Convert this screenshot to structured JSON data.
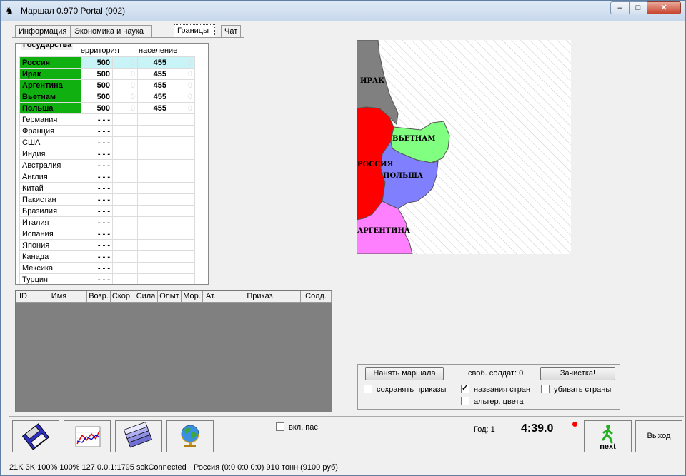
{
  "window": {
    "title": "Маршал 0.970   Portal (002)",
    "controls": {
      "minimize": "–",
      "maximize": "□",
      "close": "✕"
    }
  },
  "tabs": [
    {
      "label": "Информация"
    },
    {
      "label": "Экономика и наука"
    },
    {
      "label": "Границы"
    },
    {
      "label": "Чат"
    }
  ],
  "states_panel": {
    "title": "Государства",
    "headers": {
      "territory": "территория",
      "population": "население"
    },
    "rows": [
      {
        "name": "Россия",
        "territory": "500",
        "population": "455",
        "extra1": "0",
        "extra2": "0"
      },
      {
        "name": "Ирак",
        "territory": "500",
        "population": "455",
        "extra1": "0",
        "extra2": "0"
      },
      {
        "name": "Аргентина",
        "territory": "500",
        "population": "455",
        "extra1": "0",
        "extra2": "0"
      },
      {
        "name": "Вьетнам",
        "territory": "500",
        "population": "455",
        "extra1": "0",
        "extra2": "0"
      },
      {
        "name": "Польша",
        "territory": "500",
        "population": "455",
        "extra1": "0",
        "extra2": "0"
      },
      {
        "name": "Германия",
        "territory": "- - -",
        "population": "",
        "extra1": "",
        "extra2": ""
      },
      {
        "name": "Франция",
        "territory": "- - -",
        "population": "",
        "extra1": "",
        "extra2": ""
      },
      {
        "name": "США",
        "territory": "- - -",
        "population": "",
        "extra1": "",
        "extra2": ""
      },
      {
        "name": "Индия",
        "territory": "- - -",
        "population": "",
        "extra1": "",
        "extra2": ""
      },
      {
        "name": "Австралия",
        "territory": "- - -",
        "population": "",
        "extra1": "",
        "extra2": ""
      },
      {
        "name": "Англия",
        "territory": "- - -",
        "population": "",
        "extra1": "",
        "extra2": ""
      },
      {
        "name": "Китай",
        "territory": "- - -",
        "population": "",
        "extra1": "",
        "extra2": ""
      },
      {
        "name": "Пакистан",
        "territory": "- - -",
        "population": "",
        "extra1": "",
        "extra2": ""
      },
      {
        "name": "Бразилия",
        "territory": "- - -",
        "population": "",
        "extra1": "",
        "extra2": ""
      },
      {
        "name": "Италия",
        "territory": "- - -",
        "population": "",
        "extra1": "",
        "extra2": ""
      },
      {
        "name": "Испания",
        "territory": "- - -",
        "population": "",
        "extra1": "",
        "extra2": ""
      },
      {
        "name": "Япония",
        "territory": "- - -",
        "population": "",
        "extra1": "",
        "extra2": ""
      },
      {
        "name": "Канада",
        "territory": "- - -",
        "population": "",
        "extra1": "",
        "extra2": ""
      },
      {
        "name": "Мексика",
        "territory": "- - -",
        "population": "",
        "extra1": "",
        "extra2": ""
      },
      {
        "name": "Турция",
        "territory": "- - -",
        "population": "",
        "extra1": "",
        "extra2": ""
      }
    ]
  },
  "units_table": {
    "columns": [
      "ID",
      "Имя",
      "Возр.",
      "Скор.",
      "Сила",
      "Опыт",
      "Мор.",
      "Ат.",
      "Приказ",
      "Солд."
    ]
  },
  "map": {
    "labels": {
      "iraq": "ИРАК",
      "vietnam": "ВЬЕТНАМ",
      "russia": "РОССИЯ",
      "poland": "ПОЛЬША",
      "argentina": "АРГЕНТИНА"
    },
    "colors": {
      "iraq": "#808080",
      "russia": "#ff0000",
      "vietnam": "#80ff80",
      "poland": "#8080ff",
      "argentina": "#ff80ff",
      "background": "#ffffff",
      "hatch": "#c8c8c8"
    }
  },
  "controls": {
    "hire_button": "Нанять маршала",
    "free_soldiers": "своб. солдат: 0",
    "clear_button": "Зачистка!",
    "checkboxes": {
      "save_orders": {
        "label": "сохранять приказы",
        "checked": false
      },
      "country_names": {
        "label": "названия стран",
        "checked": true
      },
      "kill_countries": {
        "label": "убивать страны",
        "checked": false
      },
      "alt_colors": {
        "label": "альтер. цвета",
        "checked": false
      }
    }
  },
  "bottom": {
    "pass_checkbox": {
      "label": "вкл. пас",
      "checked": false
    },
    "year": "Год: 1",
    "timer": "4:39.0",
    "next_label": "next",
    "exit_label": "Выход",
    "toolbar_icons": [
      "floppy-disk-icon",
      "line-chart-icon",
      "money-stack-icon",
      "globe-icon"
    ]
  },
  "status_bar": {
    "left": "21K 3K 100% 100% 127.0.0.1:1795  sckConnected",
    "right": "Россия (0:0  0:0  0:0) 910 тонн (9100 руб)"
  }
}
